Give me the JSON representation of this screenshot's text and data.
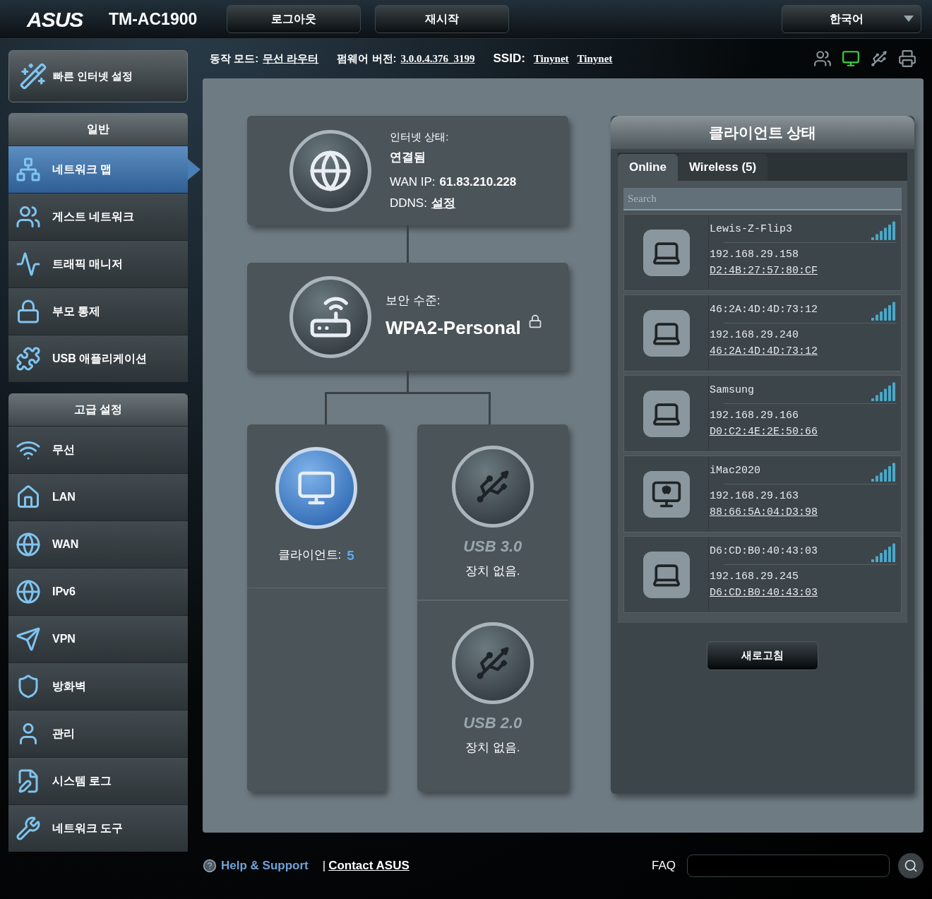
{
  "header": {
    "logo": "ASUS",
    "model": "TM-AC1900",
    "buttons": [
      "로그아웃",
      "재시작"
    ],
    "language": "한국어"
  },
  "info_bar": {
    "mode_label": "동작 모드:",
    "mode": "무선 라우터",
    "firmware_label": "펌웨어 버전:",
    "firmware": "3.0.0.4.376_3199",
    "ssid_label": "SSID:",
    "ssids": [
      "Tinynet",
      "Tinynet"
    ]
  },
  "status_icons": [
    {
      "kind": "clients",
      "on": false
    },
    {
      "kind": "internet",
      "on": true
    },
    {
      "kind": "usb",
      "on": false
    },
    {
      "kind": "printer",
      "on": false
    }
  ],
  "quick_setup": "빠른 인터넷 설정",
  "sidebar": [
    {
      "title": "일반",
      "items": [
        {
          "label": "네트워크 맵",
          "selected": true
        },
        {
          "label": "게스트 네트워크",
          "selected": false
        },
        {
          "label": "트래픽 매니저",
          "selected": false
        },
        {
          "label": "부모 통제",
          "selected": false
        },
        {
          "label": "USB 애플리케이션",
          "selected": false
        }
      ]
    },
    {
      "title": "고급 설정",
      "items": [
        {
          "label": "무선",
          "selected": false
        },
        {
          "label": "LAN",
          "selected": false
        },
        {
          "label": "WAN",
          "selected": false
        },
        {
          "label": "IPv6",
          "selected": false
        },
        {
          "label": "VPN",
          "selected": false
        },
        {
          "label": "방화벽",
          "selected": false
        },
        {
          "label": "관리",
          "selected": false
        },
        {
          "label": "시스템 로그",
          "selected": false
        },
        {
          "label": "네트워크 도구",
          "selected": false
        }
      ]
    }
  ],
  "internet": {
    "status_label": "인터넷 상태:",
    "status": "연결됨",
    "wan_label": "WAN IP:",
    "wan_ip": "61.83.210.228",
    "ddns_label": "DDNS:",
    "ddns": "설정"
  },
  "security": {
    "label": "보안 수준:",
    "value": "WPA2-Personal"
  },
  "clients_card": {
    "label": "클라이언트:",
    "count": "5"
  },
  "usb_ports": [
    {
      "name": "USB 3.0",
      "status": "장치 없음."
    },
    {
      "name": "USB 2.0",
      "status": "장치 없음."
    }
  ],
  "client_status": {
    "title": "클라이언트 상태",
    "tabs": [
      {
        "label": "Online",
        "selected": true
      },
      {
        "label": "Wireless (5)",
        "selected": false
      }
    ],
    "search_placeholder": "Search",
    "clients": [
      {
        "name": "Lewis-Z-Flip3",
        "ip": "192.168.29.158",
        "mac": "D2:4B:27:57:80:CF",
        "kind": "laptop"
      },
      {
        "name": "46:2A:4D:4D:73:12",
        "ip": "192.168.29.240",
        "mac": "46:2A:4D:4D:73:12",
        "kind": "laptop"
      },
      {
        "name": "Samsung",
        "ip": "192.168.29.166",
        "mac": "D0:C2:4E:2E:50:66",
        "kind": "laptop"
      },
      {
        "name": "iMac2020",
        "ip": "192.168.29.163",
        "mac": "88:66:5A:04:D3:98",
        "kind": "imac"
      },
      {
        "name": "D6:CD:B0:40:43:03",
        "ip": "192.168.29.245",
        "mac": "D6:CD:B0:40:43:03",
        "kind": "laptop"
      }
    ],
    "refresh": "새로고침"
  },
  "footer": {
    "help": "Help & Support",
    "separator": "|",
    "contact": "Contact ASUS",
    "faq": "FAQ"
  }
}
